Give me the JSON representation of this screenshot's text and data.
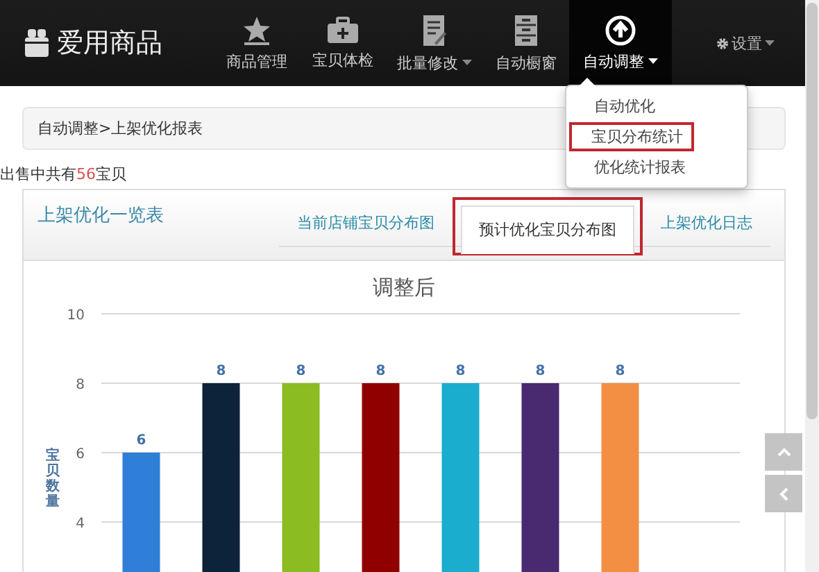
{
  "navbar": {
    "brand": "爱用商品",
    "items": [
      {
        "label": "商品管理",
        "selected": false,
        "has_caret": false
      },
      {
        "label": "宝贝体检",
        "selected": false,
        "has_caret": false
      },
      {
        "label": "批量修改",
        "selected": false,
        "has_caret": true
      },
      {
        "label": "自动橱窗",
        "selected": false,
        "has_caret": false
      },
      {
        "label": "自动调整",
        "selected": true,
        "has_caret": true
      }
    ],
    "settings": {
      "label": "设置",
      "has_caret": true
    }
  },
  "dropdown": {
    "items": [
      {
        "label": "自动优化",
        "highlighted": false
      },
      {
        "label": "宝贝分布统计",
        "highlighted": true
      },
      {
        "label": "优化统计报表",
        "highlighted": false
      }
    ]
  },
  "breadcrumb": "自动调整>上架优化报表",
  "summary": {
    "prefix": "出售中共有",
    "count": "56",
    "suffix": "宝贝"
  },
  "panel": {
    "title": "上架优化一览表",
    "tabs": [
      {
        "label": "当前店铺宝贝分布图",
        "selected": false,
        "highlighted": false
      },
      {
        "label": "预计优化宝贝分布图",
        "selected": true,
        "highlighted": true
      },
      {
        "label": "上架优化日志",
        "selected": false,
        "highlighted": false
      }
    ],
    "chart_data": {
      "type": "bar",
      "title": "调整后",
      "ylabel": "宝贝数量",
      "ylim": [
        0,
        10
      ],
      "yticks": [
        4,
        6,
        8,
        10
      ],
      "data_labels": true,
      "grid": true,
      "series": [
        {
          "colors": [
            "#2f7ed8",
            "#0d233a",
            "#8bbc21",
            "#910000",
            "#1aadce",
            "#492970",
            "#f28f43"
          ],
          "values": [
            6,
            8,
            8,
            8,
            8,
            8,
            8
          ]
        }
      ]
    }
  }
}
